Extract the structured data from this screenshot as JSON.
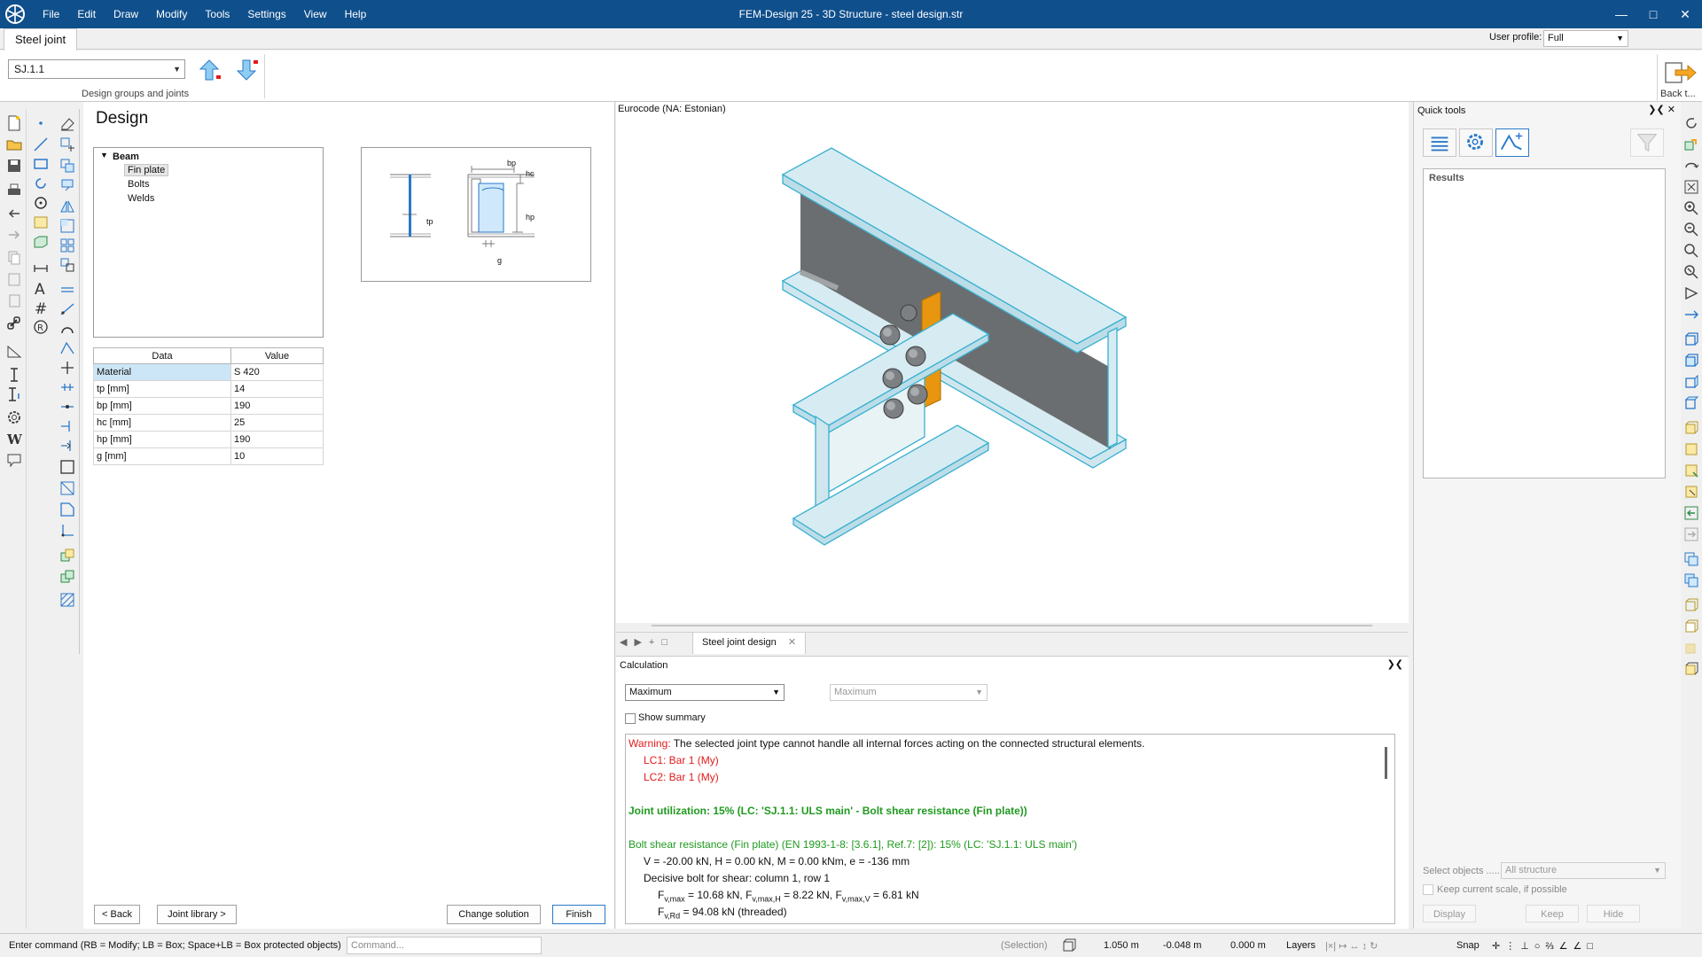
{
  "titlebar": {
    "menu": [
      "File",
      "Edit",
      "Draw",
      "Modify",
      "Tools",
      "Settings",
      "View",
      "Help"
    ],
    "title": "FEM-Design 25 - 3D Structure - steel design.str"
  },
  "ribbon": {
    "tab": "Steel joint",
    "user_profile_label": "User profile:",
    "user_profile_value": "Full",
    "joint_select": "SJ.1.1",
    "group_label": "Design groups and joints",
    "back_label": "Back t..."
  },
  "design": {
    "title": "Design",
    "tree": {
      "root": "Beam",
      "children": [
        "Fin plate",
        "Bolts",
        "Welds"
      ]
    },
    "sketch_labels": {
      "tp": "tp",
      "bp": "bp",
      "hc": "hc",
      "hp": "hp",
      "g": "g"
    },
    "table": {
      "headers": [
        "Data",
        "Value"
      ],
      "rows": [
        [
          "Material",
          "S 420"
        ],
        [
          "tp [mm]",
          "14"
        ],
        [
          "bp [mm]",
          "190"
        ],
        [
          "hc [mm]",
          "25"
        ],
        [
          "hp [mm]",
          "190"
        ],
        [
          "g [mm]",
          "10"
        ]
      ]
    },
    "buttons": {
      "back": "< Back",
      "library": "Joint library >",
      "change": "Change solution",
      "finish": "Finish"
    }
  },
  "viewport": {
    "code": "Eurocode (NA: Estonian)",
    "doc_tab": "Steel joint design"
  },
  "calc": {
    "title": "Calculation",
    "select1": "Maximum",
    "select2": "Maximum",
    "show_summary": "Show summary",
    "lines": {
      "warning_label": "Warning:",
      "warning_text": " The selected joint type cannot handle all internal forces acting on the connected structural elements.",
      "lc1": "LC1: Bar 1 (My)",
      "lc2": "LC2: Bar 1 (My)",
      "utilization": "Joint utilization: 15% (LC: 'SJ.1.1: ULS main' - Bolt shear resistance (Fin plate))",
      "bolt_shear": "Bolt shear resistance (Fin plate) (EN 1993-1-8: [3.6.1], Ref.7: [2]): 15% (LC: 'SJ.1.1: ULS main')",
      "forces": "V = -20.00 kN, H = 0.00 kN, M = 0.00 kNm, e = -136 mm",
      "decisive": "Decisive bolt for shear: column 1, row 1",
      "fv_max_pre": "F",
      "fv_max_sub": "v,max",
      "fv_max_val": " = 10.68 kN, ",
      "fvh_pre": "F",
      "fvh_sub": "v,max,H",
      "fvh_val": " = 8.22 kN, ",
      "fvv_pre": "F",
      "fvv_sub": "v,max,V",
      "fvv_val": " = 6.81 kN",
      "fvrd_pre": "F",
      "fvrd_sub": "v,Rd",
      "fvrd_val": " = 94.08 kN (threaded)"
    }
  },
  "quick_tools": {
    "title": "Quick tools",
    "results": "Results",
    "select_objects_label": "Select objects .....",
    "select_objects_value": "All structure",
    "keep_scale": "Keep current scale, if possible",
    "display": "Display",
    "keep": "Keep",
    "hide": "Hide"
  },
  "status": {
    "command_hint": "Enter command (RB = Modify; LB = Box; Space+LB = Box protected objects)",
    "command_placeholder": "Command...",
    "selection": "(Selection)",
    "x": "1.050 m",
    "y": "-0.048 m",
    "z": "0.000 m",
    "layers": "Layers",
    "snap": "Snap"
  },
  "colors": {
    "titlebar": "#0f4f8c",
    "steel": "#d6ecf2",
    "web_shadow": "#6b6e70",
    "fin_plate": "#e8960f"
  }
}
